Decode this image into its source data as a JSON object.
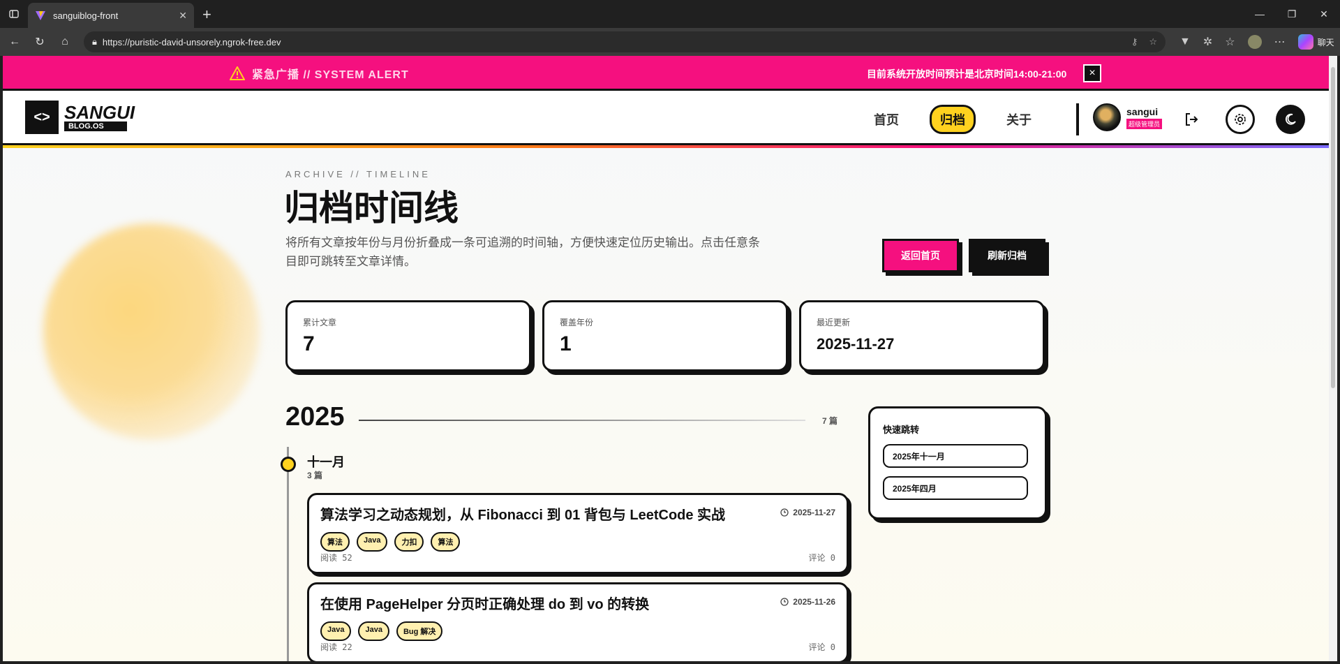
{
  "browser": {
    "tab_title": "sanguiblog-front",
    "url": "https://puristic-david-unsorely.ngrok-free.dev",
    "chat_label": "聊天"
  },
  "alert": {
    "title": "紧急广播 // SYSTEM ALERT",
    "message": "目前系统开放时间预计是北京时间14:00-21:00",
    "close_icon": "×"
  },
  "header": {
    "logo_symbol": "<>",
    "logo_name": "SANGUI",
    "logo_sub": "BLOG.OS",
    "nav": [
      {
        "label": "首页",
        "active": false
      },
      {
        "label": "归档",
        "active": true
      },
      {
        "label": "关于",
        "active": false
      }
    ],
    "user": {
      "name": "sangui",
      "role": "超级管理员"
    }
  },
  "archive": {
    "eyebrow": "ARCHIVE // TIMELINE",
    "title": "归档时间线",
    "intro": "将所有文章按年份与月份折叠成一条可追溯的时间轴，方便快速定位历史输出。点击任意条目即可跳转至文章详情。",
    "back_button": "返回首页",
    "refresh_button": "刷新归档",
    "stats": [
      {
        "label": "累计文章",
        "value": "7"
      },
      {
        "label": "覆盖年份",
        "value": "1"
      },
      {
        "label": "最近更新",
        "value": "2025-11-27"
      }
    ],
    "year": "2025",
    "year_count": "7 篇",
    "month": "十一月",
    "month_count": "3 篇",
    "posts": [
      {
        "title": "算法学习之动态规划，从 Fibonacci 到 01 背包与 LeetCode 实战",
        "date": "2025-11-27",
        "tags": [
          "算法",
          "Java",
          "力扣",
          "算法"
        ],
        "views": "阅读 52",
        "comments": "评论 0"
      },
      {
        "title": "在使用 PageHelper 分页时正确处理 do 到 vo 的转换",
        "date": "2025-11-26",
        "tags": [
          "Java",
          "Java",
          "Bug 解决"
        ],
        "views": "阅读 22",
        "comments": "评论 0"
      }
    ],
    "quick_jump": {
      "title": "快速跳转",
      "items": [
        "2025年十一月",
        "2025年四月"
      ]
    }
  }
}
